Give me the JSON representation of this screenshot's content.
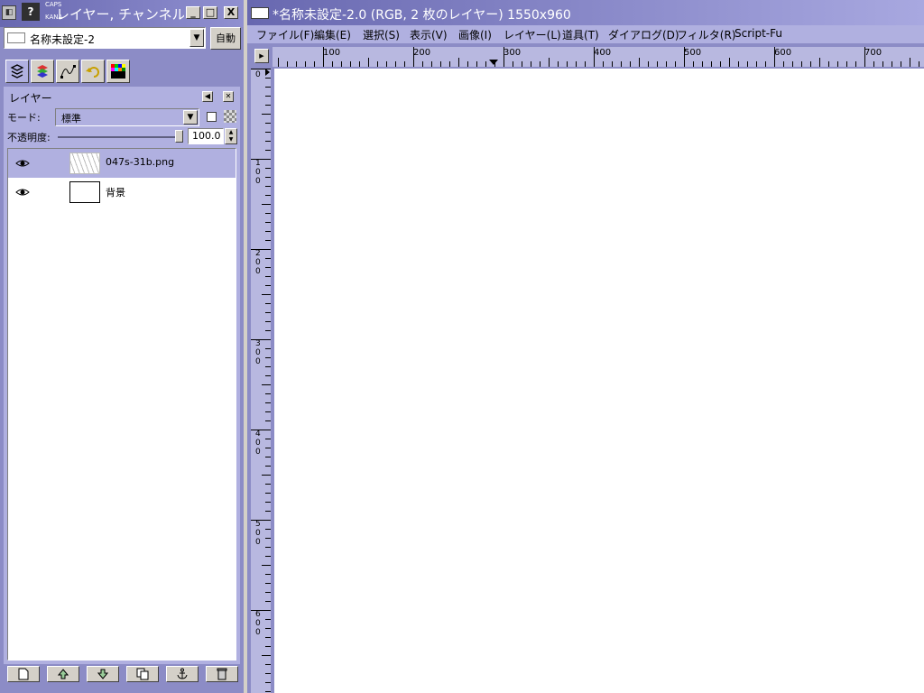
{
  "dock": {
    "title": "レイヤー, チャンネル, パス, ...",
    "caps": "CAPS",
    "kana": "KANA",
    "caps_glyph": "?",
    "minimize": "_",
    "maximize": "□",
    "close": "X",
    "image_selector": "名称未設定-2",
    "auto_button": "自動",
    "tabs": [
      "layers-icon",
      "channels-icon",
      "paths-icon",
      "undo-icon",
      "palette-icon"
    ]
  },
  "layers_panel": {
    "title": "レイヤー",
    "mode_label": "モード:",
    "mode_value": "標準",
    "opacity_label": "不透明度:",
    "opacity_value": "100.0",
    "layers": [
      {
        "name": "047s-31b.png",
        "visible": true,
        "selected": true
      },
      {
        "name": "背景",
        "visible": true,
        "selected": false
      }
    ],
    "toolbar": [
      "new-layer-icon",
      "raise-layer-icon",
      "lower-layer-icon",
      "duplicate-layer-icon",
      "anchor-layer-icon",
      "delete-layer-icon"
    ]
  },
  "image_window": {
    "title": "*名称未設定-2.0 (RGB, 2 枚のレイヤー) 1550x960",
    "menus": [
      "ファイル(F)",
      "編集(E)",
      "選択(S)",
      "表示(V)",
      "画像(I)",
      "レイヤー(L)",
      "道具(T)",
      "ダイアログ(D)",
      "フィルタ(R)",
      "Script-Fu"
    ],
    "ruler_h_labels": [
      "100",
      "200",
      "300",
      "400",
      "500",
      "600",
      "700"
    ],
    "ruler_v_labels": [
      "0",
      "100",
      "200",
      "300",
      "400",
      "500",
      "600"
    ]
  },
  "colors": {
    "titlebar": "#6868b0",
    "panel": "#b0b0e0",
    "window_bg": "#8c8cc6",
    "canvas": "#ffffff"
  }
}
